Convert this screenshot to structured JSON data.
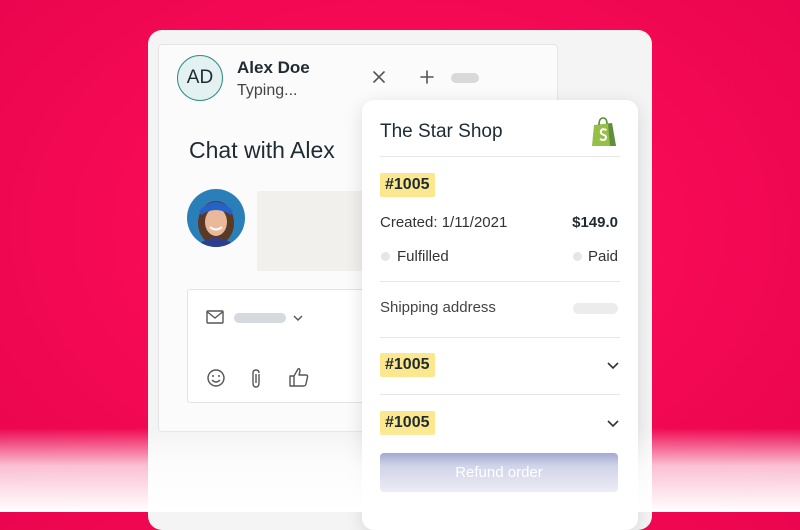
{
  "contact": {
    "initials": "AD",
    "name": "Alex Doe",
    "status": "Typing..."
  },
  "chat": {
    "title": "Chat with Alex"
  },
  "shop": {
    "name": "The Star Shop",
    "order_number": "#1005",
    "created": "Created: 1/11/2021",
    "total": "$149.0",
    "fulfillment_status": "Fulfilled",
    "payment_status": "Paid",
    "shipping_label": "Shipping address",
    "orders": [
      "#1005",
      "#1005"
    ],
    "refund_label": "Refund order"
  },
  "colors": {
    "background": "#f70a56",
    "badge": "#fbe78d",
    "button": "#4754a6",
    "shopify": "#95bf47",
    "avatar_border": "#2f8f8a"
  },
  "icons": [
    "close-icon",
    "plus-icon",
    "mail-icon",
    "chevron-down-icon",
    "emoji-icon",
    "paperclip-icon",
    "thumbs-up-icon",
    "shopify-bag-icon"
  ]
}
